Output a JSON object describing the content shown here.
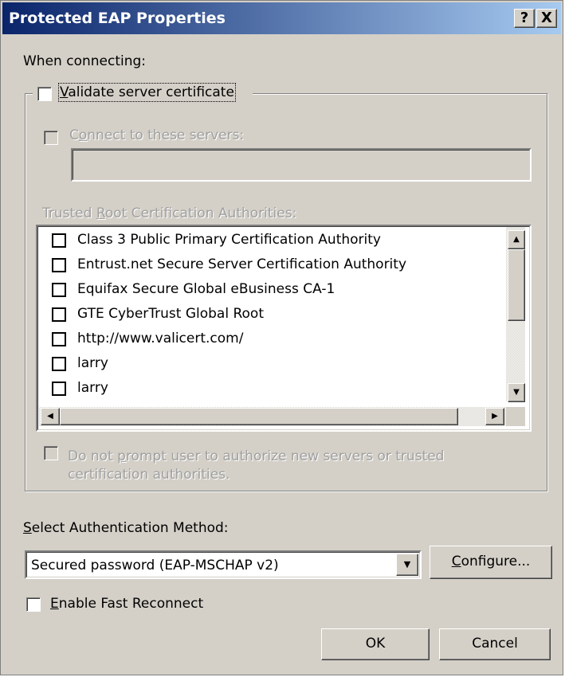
{
  "window": {
    "title": "Protected EAP Properties",
    "help_btn": "?",
    "close_btn": "X"
  },
  "when_connecting": "When connecting:",
  "validate": {
    "pre": "",
    "ul": "V",
    "post": "alidate server certificate"
  },
  "connect_servers": {
    "pre": "C",
    "ul": "o",
    "post": "nnect to these servers:"
  },
  "servers_value": "",
  "trusted_root": {
    "pre": "Trusted ",
    "ul": "R",
    "post": "oot Certification Authorities:"
  },
  "ca_list": [
    "Class 3 Public Primary Certification Authority",
    "Entrust.net Secure Server Certification Authority",
    "Equifax Secure Global eBusiness CA-1",
    "GTE CyberTrust Global Root",
    "http://www.valicert.com/",
    "larry",
    "larry"
  ],
  "do_not_prompt": {
    "line1_pre": "Do not ",
    "line1_ul": "p",
    "line1_post": "rompt user to authorize new servers or trusted",
    "line2": "certification authorities."
  },
  "auth_method_label": {
    "pre": "",
    "ul": "S",
    "post": "elect Authentication Method:"
  },
  "auth_method_value": "Secured password (EAP-MSCHAP v2)",
  "configure": {
    "pre": "",
    "ul": "C",
    "post": "onfigure..."
  },
  "fast_reconnect": {
    "pre": "",
    "ul": "E",
    "post": "nable Fast Reconnect"
  },
  "ok": "OK",
  "cancel": "Cancel",
  "icons": {
    "scroll_up": "▲",
    "scroll_down": "▼",
    "scroll_left": "◀",
    "scroll_right": "▶",
    "dropdown": "▼"
  }
}
